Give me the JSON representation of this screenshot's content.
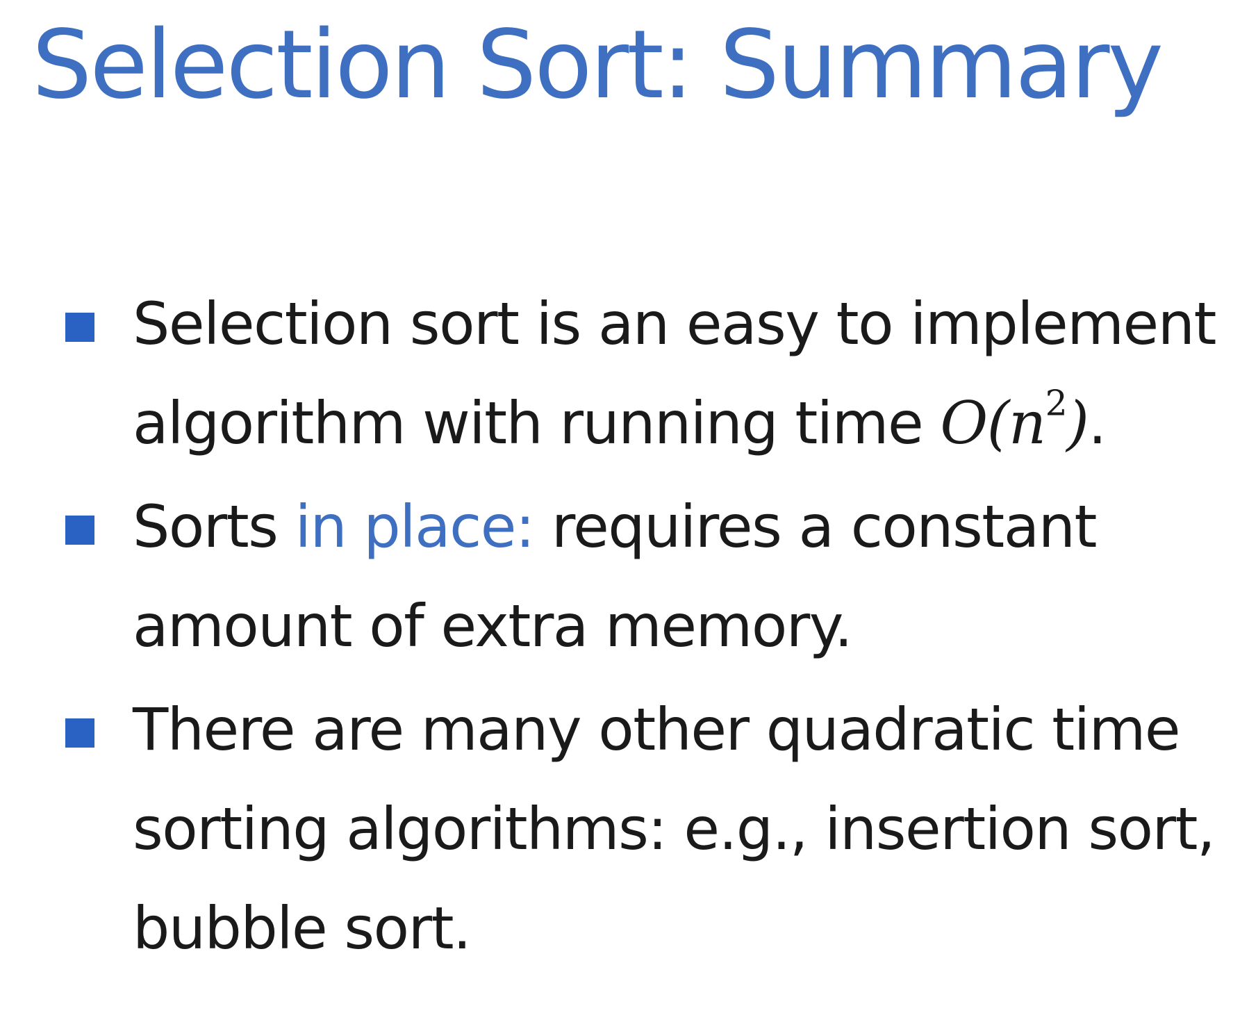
{
  "slide": {
    "title": "Selection Sort: Summary",
    "accent_color": "#3f6fc0",
    "bullet_color": "#2a62c4",
    "bullets": [
      {
        "text_before": "Selection sort is an easy to implement algorithm with running time ",
        "math_base": "O(n",
        "math_exponent": "2",
        "math_close": ")",
        "text_after": "."
      },
      {
        "text_before": "Sorts ",
        "highlight": "in place:",
        "text_after": " requires a constant amount of extra memory."
      },
      {
        "text": "There are many other quadratic time sorting algorithms: e.g., insertion sort, bubble sort."
      }
    ]
  }
}
